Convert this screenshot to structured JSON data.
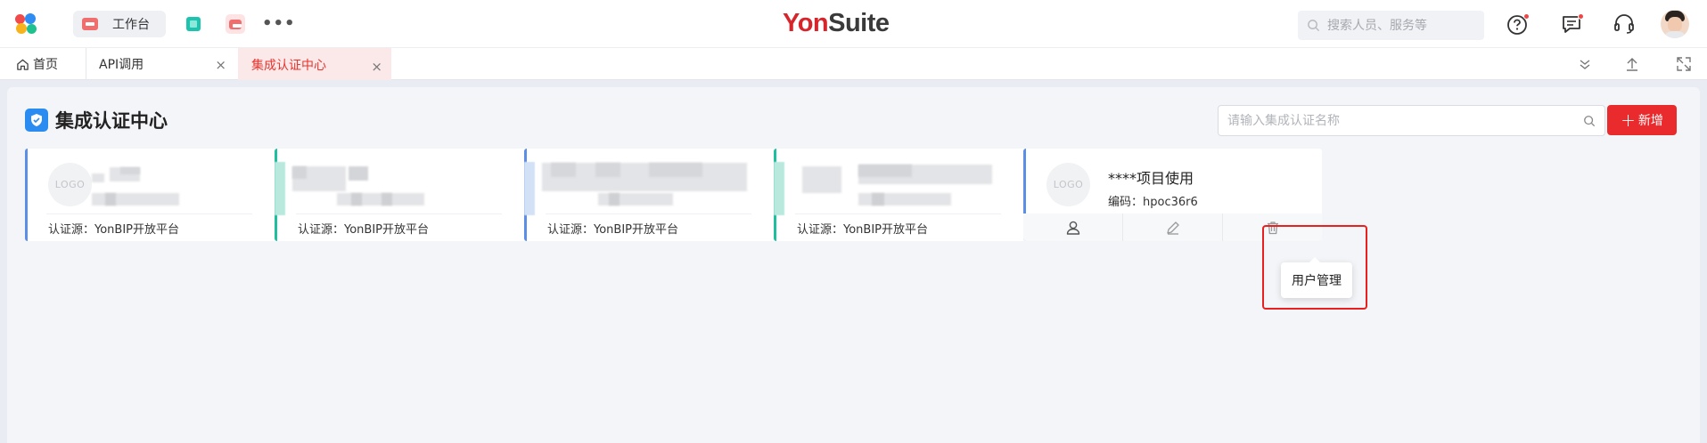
{
  "header": {
    "brand_part1": "Yon",
    "brand_part2": "Suite",
    "workspace_tab": "工作台",
    "more": "•••",
    "search_placeholder": "搜索人员、服务等"
  },
  "tabs": {
    "home": "首页",
    "api": "API调用",
    "active": "集成认证中心",
    "close_glyph": "×"
  },
  "page": {
    "title": "集成认证中心",
    "search_placeholder": "请输入集成认证名称",
    "add_button": "新增",
    "add_plus": "+"
  },
  "cards": [
    {
      "logo": "LOGO",
      "name": "",
      "code": "",
      "source": "认证源：YonBIP开放平台",
      "accent": "#5b8ee6"
    },
    {
      "logo": "",
      "name": "",
      "code": "",
      "source": "认证源：YonBIP开放平台",
      "accent": "#1dbf9f"
    },
    {
      "logo": "",
      "name": "",
      "code": "",
      "source": "认证源：YonBIP开放平台",
      "accent": "#5b8ee6"
    },
    {
      "logo": "",
      "name": "",
      "code": "",
      "source": "认证源：YonBIP开放平台",
      "accent": "#1dbf9f"
    },
    {
      "logo": "LOGO",
      "name": "****项目使用",
      "code": "编码：hpoc36r6",
      "accent": "#5b8ee6"
    }
  ],
  "tooltip": "用户管理",
  "colors": {
    "brand_red": "#d6262c",
    "primary_red": "#ea2b2e",
    "active_tab_bg": "#fbe9ea",
    "highlight": "#e8201f"
  },
  "icons": [
    "app-logo-icon",
    "workspace-card-icon",
    "cube-app-icon",
    "red-app-icon",
    "search-icon",
    "help-icon",
    "message-icon",
    "headset-icon",
    "home-icon",
    "close-icon",
    "chevron-down-icon",
    "upload-icon",
    "fullscreen-icon",
    "shield-icon",
    "user-icon",
    "edit-icon",
    "delete-icon"
  ]
}
